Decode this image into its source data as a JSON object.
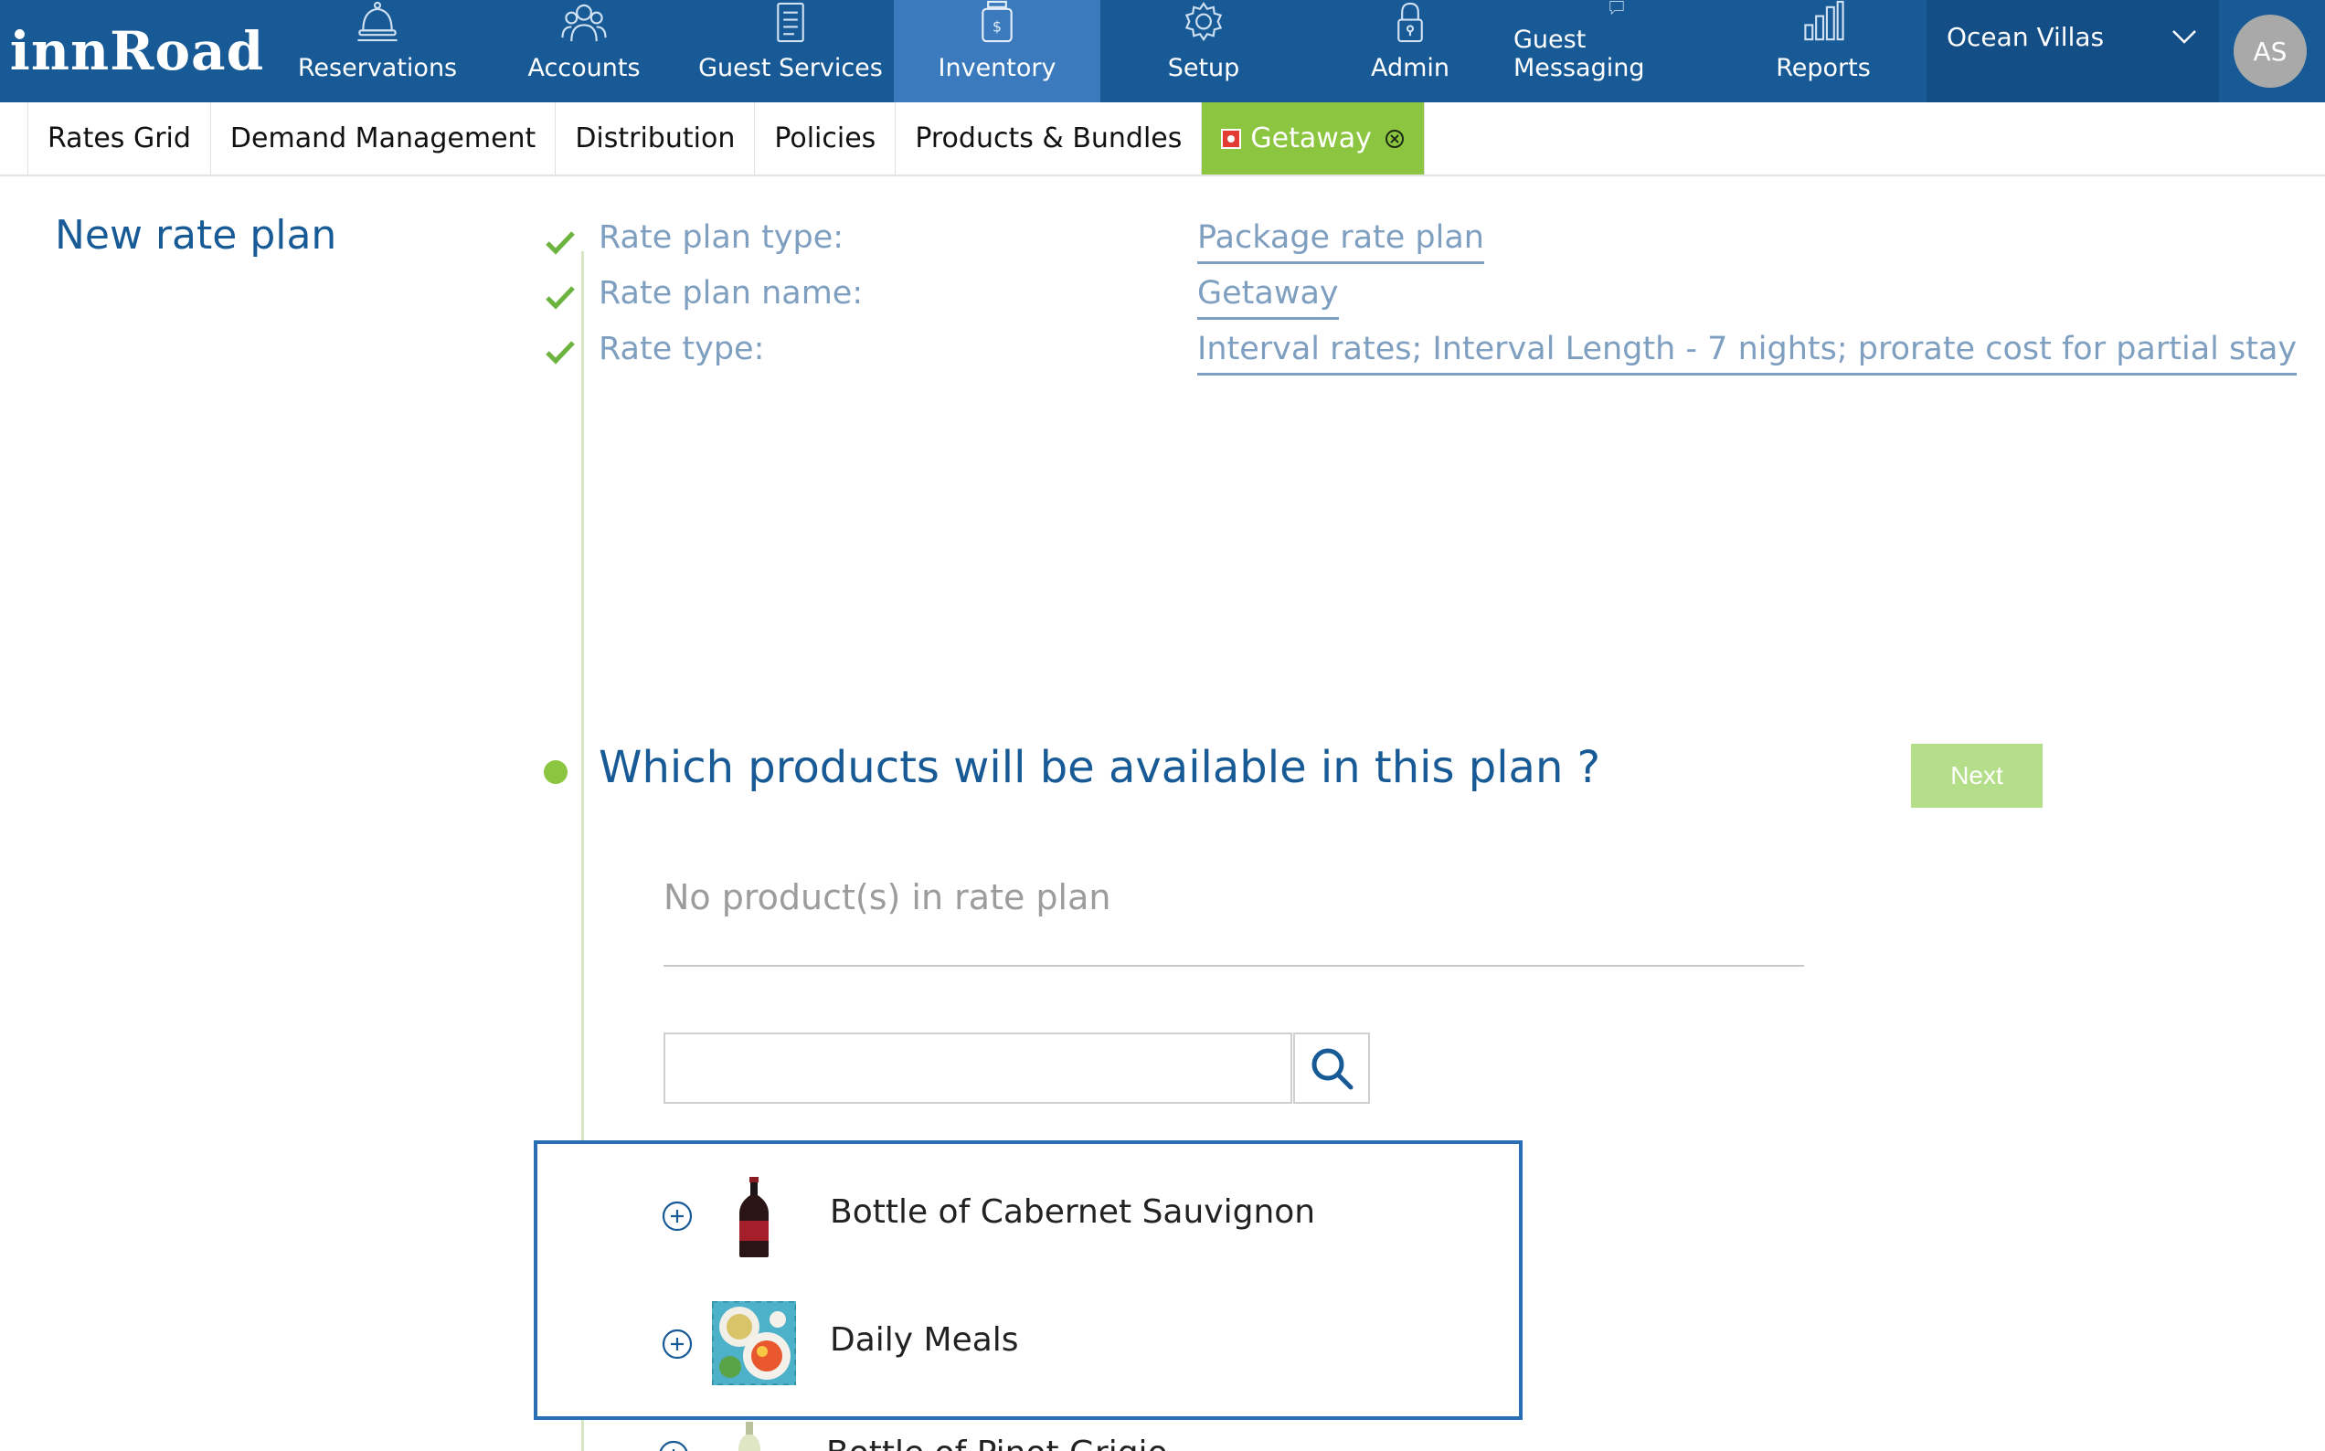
{
  "app": {
    "logo": "innRoad"
  },
  "nav": {
    "items": [
      {
        "label": "Reservations",
        "icon": "bell-icon"
      },
      {
        "label": "Accounts",
        "icon": "people-icon"
      },
      {
        "label": "Guest Services",
        "icon": "clipboard-icon"
      },
      {
        "label": "Inventory",
        "icon": "money-jar-icon",
        "active": true
      },
      {
        "label": "Setup",
        "icon": "gear-icon"
      },
      {
        "label": "Admin",
        "icon": "lock-icon"
      },
      {
        "label": "Guest Messaging",
        "icon": "chat-icon"
      },
      {
        "label": "Reports",
        "icon": "bar-chart-icon"
      }
    ],
    "property": "Ocean Villas",
    "avatar": "AS"
  },
  "subtabs": {
    "items": [
      "Rates Grid",
      "Demand Management",
      "Distribution",
      "Policies",
      "Products & Bundles"
    ],
    "active_tab": "Getaway"
  },
  "page": {
    "title": "New rate plan"
  },
  "steps": [
    {
      "label": "Rate plan type:",
      "value": "Package rate plan"
    },
    {
      "label": "Rate plan name:",
      "value": "Getaway"
    },
    {
      "label": "Rate type:",
      "value": "Interval rates; Interval Length - 7 nights; prorate cost for partial stay"
    }
  ],
  "products_step": {
    "question": "Which products will be available in this plan ?",
    "next_label": "Next",
    "empty_text": "No product(s) in rate plan",
    "search_value": "",
    "items": [
      {
        "name": "Bottle of Cabernet Sauvignon",
        "image": "wine-bottle"
      },
      {
        "name": "Daily Meals",
        "image": "meal-plate"
      },
      {
        "name": "Bottle of Pinot Grigio",
        "image": "white-wine-bottle"
      }
    ]
  },
  "colors": {
    "nav_bg": "#175a96",
    "nav_active": "#3b7bbd",
    "accent_green": "#8cc540",
    "title_blue": "#175a96",
    "muted_blue": "#7f9fc1"
  }
}
